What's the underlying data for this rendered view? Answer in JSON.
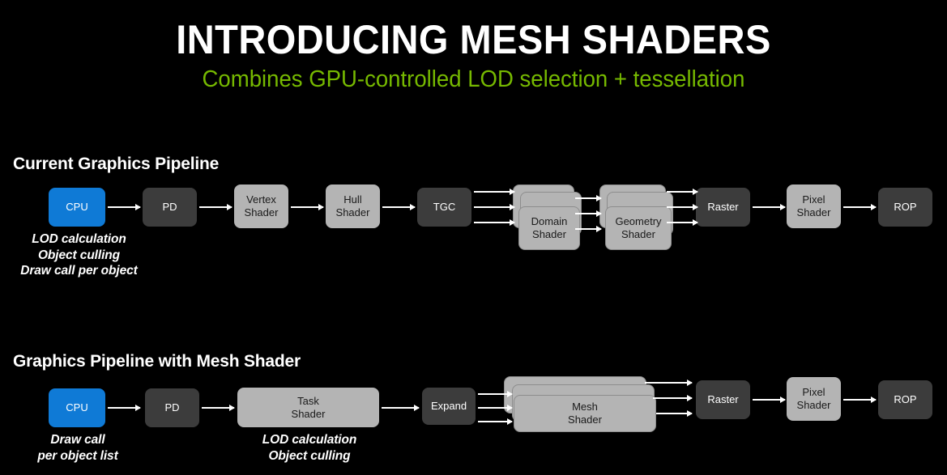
{
  "slide": {
    "title": "INTRODUCING MESH SHADERS",
    "subtitle": "Combines GPU-controlled LOD selection + tessellation",
    "background_color": "#000000",
    "accent_color": "#76b900"
  },
  "colors": {
    "title_text": "#ffffff",
    "subtitle_text": "#76b900",
    "node_dark": "#3c3c3c",
    "node_light": "#b4b4b4",
    "node_blue": "#0f7ad6",
    "arrow": "#ffffff"
  },
  "pipelines": [
    {
      "heading": "Current Graphics Pipeline",
      "nodes": [
        {
          "label": "CPU",
          "style": "blue",
          "stacked": false
        },
        {
          "label": "PD",
          "style": "dark",
          "stacked": false
        },
        {
          "label": "Vertex\nShader",
          "style": "light",
          "stacked": false
        },
        {
          "label": "Hull\nShader",
          "style": "light",
          "stacked": false
        },
        {
          "label": "TGC",
          "style": "dark",
          "stacked": false
        },
        {
          "label": "Domain\nShader",
          "style": "light",
          "stacked": true
        },
        {
          "label": "Geometry\nShader",
          "style": "light",
          "stacked": true
        },
        {
          "label": "Raster",
          "style": "dark",
          "stacked": false
        },
        {
          "label": "Pixel\nShader",
          "style": "light",
          "stacked": false
        },
        {
          "label": "ROP",
          "style": "dark",
          "stacked": false
        }
      ],
      "captions": [
        {
          "text": "LOD calculation\nObject culling\nDraw call per object",
          "under": "CPU"
        }
      ]
    },
    {
      "heading": "Graphics Pipeline with Mesh Shader",
      "nodes": [
        {
          "label": "CPU",
          "style": "blue",
          "stacked": false
        },
        {
          "label": "PD",
          "style": "dark",
          "stacked": false
        },
        {
          "label": "Task\nShader",
          "style": "light",
          "stacked": false
        },
        {
          "label": "Expand",
          "style": "dark",
          "stacked": false
        },
        {
          "label": "Mesh\nShader",
          "style": "light",
          "stacked": true
        },
        {
          "label": "Raster",
          "style": "dark",
          "stacked": false
        },
        {
          "label": "Pixel\nShader",
          "style": "light",
          "stacked": false
        },
        {
          "label": "ROP",
          "style": "dark",
          "stacked": false
        }
      ],
      "captions": [
        {
          "text": "Draw call\nper object list",
          "under": "CPU"
        },
        {
          "text": "LOD calculation\nObject culling",
          "under": "Task Shader"
        }
      ]
    }
  ]
}
